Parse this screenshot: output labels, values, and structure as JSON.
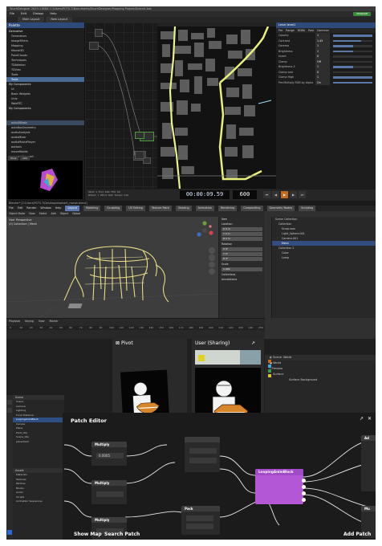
{
  "touchdesigner": {
    "title": "TouchDesigner 2023.11880: C:/Users/PCTS-7/Documents/TouchDesigner/Mapping Project/Scene1.toe",
    "menu": [
      "File",
      "Edit",
      "Dialogs",
      "Help"
    ],
    "upgrade": "UPGRADE",
    "tabs": [
      "Main Layout",
      "New Layout"
    ],
    "palette_title": "Palette",
    "palette_items": [
      {
        "label": "Derivative",
        "folder": true
      },
      {
        "label": "Generators",
        "folder": false
      },
      {
        "label": "ImageFilters",
        "folder": false
      },
      {
        "label": "Mapping",
        "folder": false
      },
      {
        "label": "Mouse3D",
        "folder": false
      },
      {
        "label": "PointClouds",
        "folder": false
      },
      {
        "label": "Techniques",
        "folder": false
      },
      {
        "label": "TDAbleton",
        "folder": false
      },
      {
        "label": "TDVrec",
        "folder": false
      },
      {
        "label": "Tools",
        "folder": false
      },
      {
        "label": "Tools",
        "folder": false,
        "selected": true
      },
      {
        "label": "My Components",
        "folder": true
      },
      {
        "label": "UI",
        "folder": false
      },
      {
        "label": "Basic Widgets",
        "folder": false
      },
      {
        "label": "Unix",
        "folder": false
      },
      {
        "label": "WebRTC",
        "folder": false
      },
      {
        "label": "My Components",
        "folder": true
      },
      {
        "label": "",
        "folder": false
      },
      {
        "label": "",
        "folder": false
      },
      {
        "label": "autoUIBasic",
        "folder": false,
        "highlight": true
      },
      {
        "label": "autoBoxGeometry",
        "folder": false
      },
      {
        "label": "audioAnalysis",
        "folder": false
      },
      {
        "label": "audioMixer",
        "folder": false
      },
      {
        "label": "audioMoviePlayer",
        "folder": false
      },
      {
        "label": "buttons",
        "folder": false
      },
      {
        "label": "moveMobile",
        "folder": false
      },
      {
        "label": "cameraViewport",
        "folder": false
      }
    ],
    "palette_buttons": [
      "Tools",
      "Add"
    ],
    "params": {
      "title": "Level  level1",
      "tabs": [
        "Pre",
        "Range",
        "RGBA",
        "Post",
        "Common"
      ],
      "rows": [
        {
          "label": "Opacity",
          "value": "1",
          "level": 1.0
        },
        {
          "label": "Contrast",
          "value": "1.45",
          "level": 0.72
        },
        {
          "label": "Gamma",
          "value": "1",
          "level": 0.5
        },
        {
          "label": "Brightness",
          "value": "1",
          "level": 0.5
        },
        {
          "label": "Invert",
          "value": "0",
          "level": 0.0
        },
        {
          "label": "Clamp",
          "value": "Off",
          "level": 0.0
        },
        {
          "label": "Brightness 2",
          "value": "1",
          "level": 0.5
        },
        {
          "label": "Clamp Low",
          "value": "0",
          "level": 0.0
        },
        {
          "label": "Clamp High",
          "value": "1",
          "level": 1.0
        },
        {
          "label": "Pre-Multiply RGB by Alpha",
          "value": "On",
          "level": 1.0
        }
      ]
    },
    "timeline": {
      "start": "Start: 1",
      "end": "End: 600",
      "rstart": "RStart: 1",
      "rend": "REnd: 600",
      "fps": "FPS: 60",
      "tempo": "Tempo: 120",
      "timecode": "00:00:09.59",
      "frame": "600"
    }
  },
  "blender": {
    "title": "Blender* [C:\\Users\\PCTS-7\\Desktop\\elephant_morph.blend]",
    "menu": [
      "File",
      "Edit",
      "Render",
      "Window",
      "Help"
    ],
    "workspaces": [
      "Layout",
      "Modeling",
      "Sculpting",
      "UV Editing",
      "Texture Paint",
      "Shading",
      "Animation",
      "Rendering",
      "Compositing",
      "Geometry Nodes",
      "Scripting"
    ],
    "header": [
      "Object Mode",
      "View",
      "Select",
      "Add",
      "Object",
      "Global"
    ],
    "viewport_label": "User Perspective",
    "viewport_sub": "(0) Collection | Mesh",
    "npanel": [
      {
        "section": "Item"
      },
      {
        "section": "Location"
      },
      {
        "field": "X  0 m"
      },
      {
        "field": "Y  0 m"
      },
      {
        "field": "Z  0 m"
      },
      {
        "section": "Rotation"
      },
      {
        "field": "X  0°"
      },
      {
        "field": "Y  0°"
      },
      {
        "field": "Z  0°"
      },
      {
        "section": "Scale"
      },
      {
        "field": "1.000"
      },
      {
        "section": "Collections"
      },
      {
        "section": "Annotations"
      }
    ],
    "outliner": [
      {
        "label": "Scene Collection",
        "selected": false
      },
      {
        "label": "Collection",
        "selected": false
      },
      {
        "label": "Scrap.wav",
        "selected": false
      },
      {
        "label": "Light_Sphere.001",
        "selected": false
      },
      {
        "label": "Camera.001",
        "selected": false
      },
      {
        "label": "Mesh",
        "selected": true
      },
      {
        "label": "Collection 2",
        "selected": false
      },
      {
        "label": "Cube",
        "selected": false
      },
      {
        "label": "Lamp",
        "selected": false
      }
    ],
    "timeline_head": [
      "Playback",
      "Keying",
      "View",
      "Marker"
    ],
    "ruler": [
      "0",
      "10",
      "20",
      "30",
      "40",
      "50",
      "60",
      "70",
      "80",
      "90",
      "100",
      "110",
      "120",
      "130",
      "140",
      "150",
      "160",
      "170",
      "180",
      "190",
      "200",
      "210",
      "220",
      "230",
      "240",
      "250"
    ]
  },
  "lower": {
    "pivot_label": "Pivot",
    "user_label": "User (Sharing)",
    "props_rows": [
      "Scene",
      "World",
      "Preview",
      "Surface",
      "Surface  Background"
    ],
    "scene_panel_title": "Scene",
    "scene_items": [
      {
        "label": "Scene",
        "selected": false
      },
      {
        "label": "Camera",
        "selected": false
      },
      {
        "label": "Lighting",
        "selected": false
      },
      {
        "label": "Focal Distance",
        "selected": false
      },
      {
        "label": "LoopingAnimBlock",
        "selected": true
      },
      {
        "label": "Canvas",
        "selected": false
      },
      {
        "label": "Plane",
        "selected": false
      },
      {
        "label": "Pivot_Obj",
        "selected": false
      },
      {
        "label": "Scene_Obj",
        "selected": false
      },
      {
        "label": "planeTrack",
        "selected": false
      }
    ],
    "assets_title": "Assets",
    "assets": [
      "Materials",
      "Textures",
      "Patches",
      "Blocks",
      "Audio",
      "Scripts",
      "Animation Sequences"
    ],
    "patch_title": "Patch Editor",
    "multiply_label": "Multiply",
    "multiply_value": "0.0005",
    "pack_label": "Pack",
    "looping_label": "LoopingAnimBlock",
    "add_label": "Ad",
    "mul_label": "Mu",
    "show_map": "Show Map",
    "search_patch": "Search Patch",
    "add_patch": "Add Patch"
  }
}
